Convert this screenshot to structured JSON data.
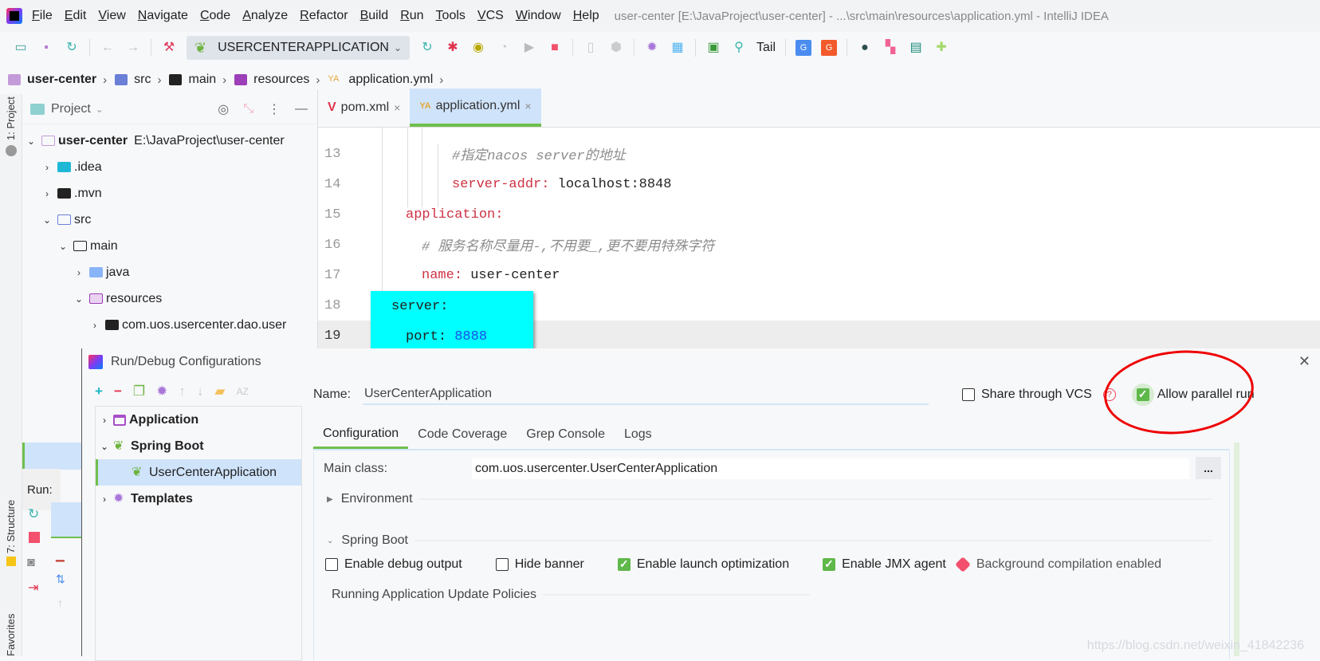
{
  "menubar": {
    "items": [
      "File",
      "Edit",
      "View",
      "Navigate",
      "Code",
      "Analyze",
      "Refactor",
      "Build",
      "Run",
      "Tools",
      "VCS",
      "Window",
      "Help"
    ],
    "window_title": "user-center [E:\\JavaProject\\user-center] - ...\\src\\main\\resources\\application.yml - IntelliJ IDEA"
  },
  "toolbar": {
    "run_config": "USERCENTERAPPLICATION",
    "tail_label": "Tail",
    "icons": [
      "open-folder-icon",
      "save-icon",
      "sync-icon",
      "back-icon",
      "forward-icon",
      "build-hammer-icon",
      "rerun-icon",
      "debug-icon",
      "coverage-icon",
      "profile-icon",
      "run-icon",
      "stop-icon",
      "device-icon",
      "deploy-icon",
      "settings-icon",
      "structure-icon",
      "terminal-icon",
      "search-icon",
      "translate-icon",
      "translate-alt-icon",
      "record-icon",
      "plugin-icon",
      "layout-icon",
      "puzzle-icon"
    ]
  },
  "breadcrumb": [
    {
      "label": "user-center",
      "icon": "module-folder-icon"
    },
    {
      "label": "src",
      "icon": "source-folder-icon"
    },
    {
      "label": "main",
      "icon": "folder-icon"
    },
    {
      "label": "resources",
      "icon": "resources-folder-icon"
    },
    {
      "label": "application.yml",
      "icon": "yaml-file-icon"
    }
  ],
  "left_strip": {
    "project_tab": "1: Project",
    "structure_tab": "7: Structure",
    "favorites_tab": "Favorites"
  },
  "project_panel": {
    "title": "Project",
    "tree": [
      {
        "label": "user-center",
        "detail": "E:\\JavaProject\\user-center",
        "expanded": true,
        "depth": 0
      },
      {
        "label": ".idea",
        "expanded": false,
        "depth": 1
      },
      {
        "label": ".mvn",
        "expanded": false,
        "depth": 1
      },
      {
        "label": "src",
        "expanded": true,
        "depth": 1
      },
      {
        "label": "main",
        "expanded": true,
        "depth": 2
      },
      {
        "label": "java",
        "expanded": false,
        "depth": 3
      },
      {
        "label": "resources",
        "expanded": true,
        "depth": 3
      },
      {
        "label": "com.uos.usercenter.dao.user",
        "expanded": false,
        "depth": 4
      }
    ]
  },
  "editor": {
    "tabs": [
      {
        "label": "pom.xml",
        "active": false
      },
      {
        "label": "application.yml",
        "active": true
      }
    ],
    "lines": [
      {
        "num": "13",
        "comment": "#指定nacos server的地址"
      },
      {
        "num": "14",
        "key": "server-addr",
        "value": "localhost:8848"
      },
      {
        "num": "15",
        "key": "application"
      },
      {
        "num": "16",
        "comment": "# 服务名称尽量用-,不用要_,更不要用特殊字符"
      },
      {
        "num": "17",
        "key": "name",
        "value": "user-center"
      },
      {
        "num": "18",
        "key": "server"
      },
      {
        "num": "19",
        "key": "port",
        "value": "8888"
      }
    ]
  },
  "run_panel": {
    "label": "Run:"
  },
  "dialog": {
    "title": "Run/Debug Configurations",
    "tree": [
      {
        "label": "Application",
        "type": "group",
        "expanded": false
      },
      {
        "label": "Spring Boot",
        "type": "group",
        "expanded": true
      },
      {
        "label": "UserCenterApplication",
        "type": "item",
        "selected": true
      },
      {
        "label": "Templates",
        "type": "group",
        "expanded": false
      }
    ],
    "name_label": "Name:",
    "name_value": "UserCenterApplication",
    "share_vcs": {
      "label": "Share through VCS",
      "checked": false
    },
    "allow_parallel": {
      "label": "Allow parallel run",
      "checked": true
    },
    "tabs": [
      "Configuration",
      "Code Coverage",
      "Grep Console",
      "Logs"
    ],
    "active_tab": "Configuration",
    "main_class_label": "Main class:",
    "main_class_value": "com.uos.usercenter.UserCenterApplication",
    "browse_label": "...",
    "environment_section": "Environment",
    "spring_boot_section": "Spring Boot",
    "options": [
      {
        "label": "Enable debug output",
        "checked": false
      },
      {
        "label": "Hide banner",
        "checked": false
      },
      {
        "label": "Enable launch optimization",
        "checked": true
      },
      {
        "label": "Enable JMX agent",
        "checked": true
      }
    ],
    "warning": "Background compilation enabled",
    "update_policies_section": "Running Application Update Policies"
  },
  "watermark": "https://blog.csdn.net/weixin_41842236",
  "colors": {
    "accent_green": "#6fbf4e",
    "selection_blue": "#cfe3fb",
    "yaml_key": "#cd3243",
    "highlight_cyan": "#00ffff",
    "annotation_red": "#e00000"
  }
}
